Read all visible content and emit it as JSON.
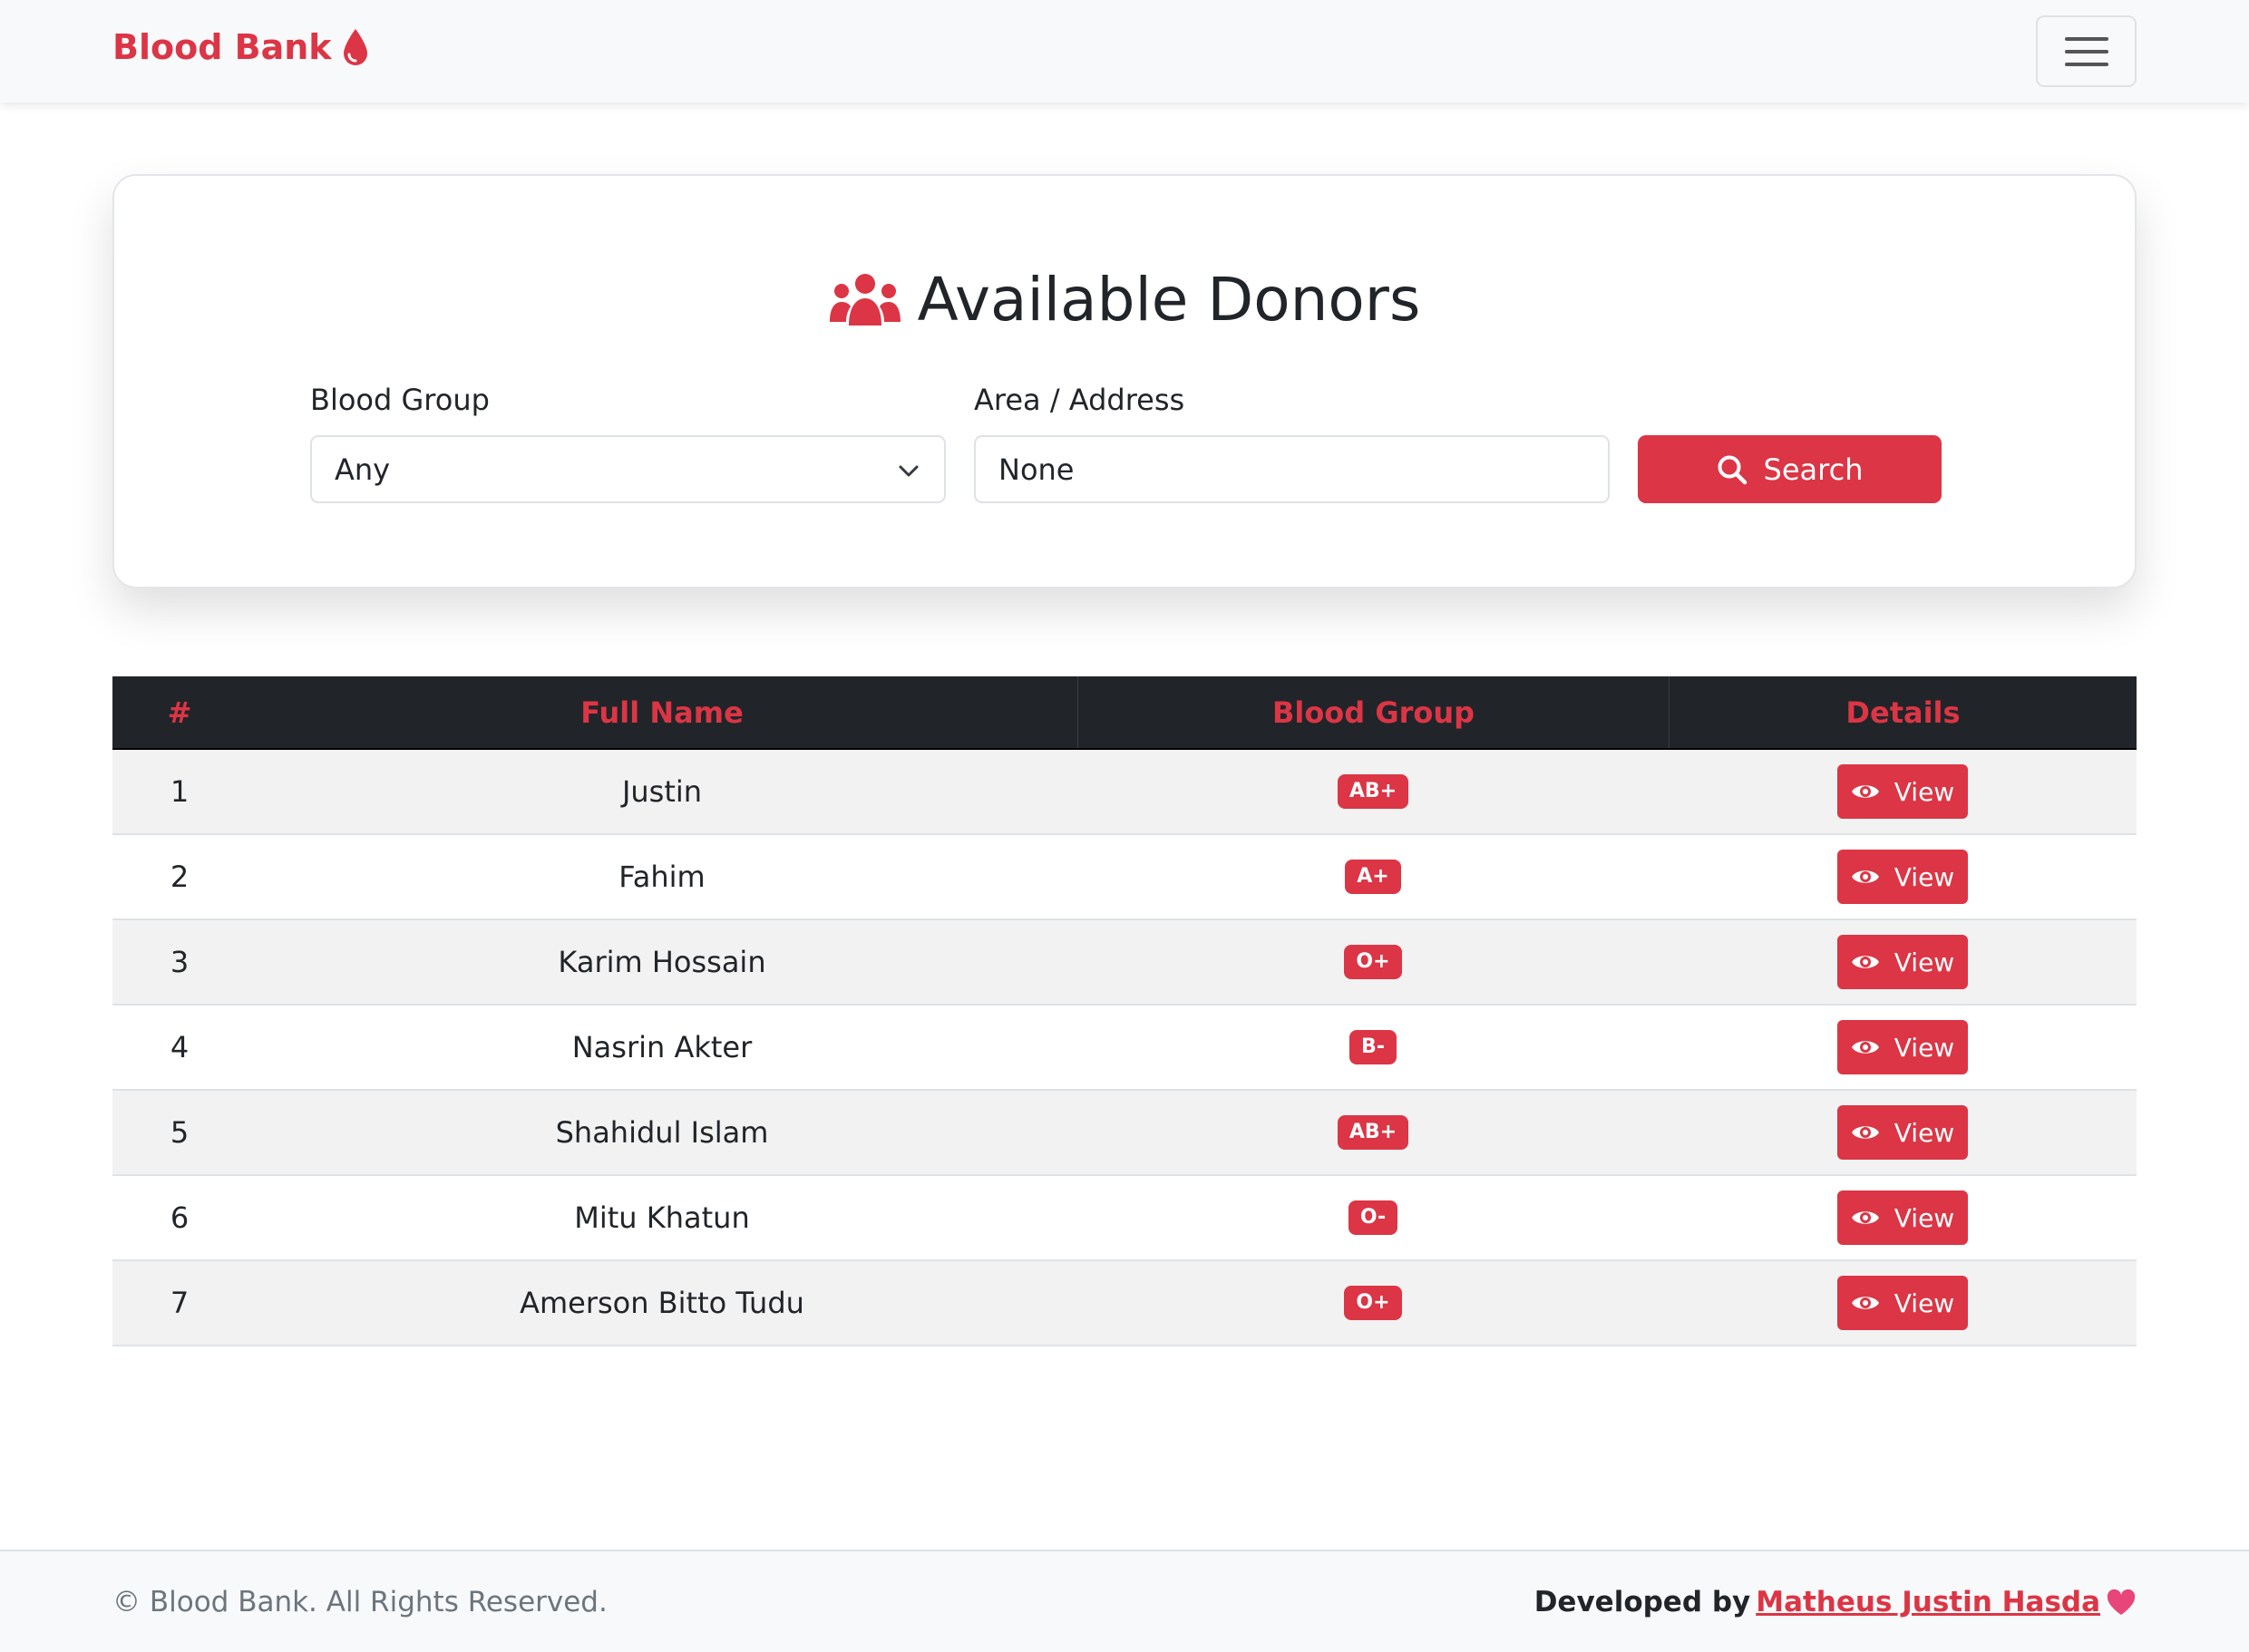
{
  "navbar": {
    "brand": "Blood Bank",
    "brand_icon": "droplet-icon",
    "menu_icon": "hamburger-icon"
  },
  "search": {
    "title": "Available Donors",
    "title_icon": "users-icon",
    "blood_group_label": "Blood Group",
    "blood_group_value": "Any",
    "area_label": "Area / Address",
    "area_value": "None",
    "search_button": "Search"
  },
  "table": {
    "headers": [
      "#",
      "Full Name",
      "Blood Group",
      "Details"
    ],
    "view_label": "View",
    "rows": [
      {
        "num": "1",
        "name": "Justin",
        "group": "AB+"
      },
      {
        "num": "2",
        "name": "Fahim",
        "group": "A+"
      },
      {
        "num": "3",
        "name": "Karim Hossain",
        "group": "O+"
      },
      {
        "num": "4",
        "name": "Nasrin Akter",
        "group": "B-"
      },
      {
        "num": "5",
        "name": "Shahidul Islam",
        "group": "AB+"
      },
      {
        "num": "6",
        "name": "Mitu Khatun",
        "group": "O-"
      },
      {
        "num": "7",
        "name": "Amerson Bitto Tudu",
        "group": "O+"
      }
    ]
  },
  "footer": {
    "copyright": "© Blood Bank. All Rights Reserved.",
    "developed_by": "Developed by",
    "developer": "Matheus Justin Hasda",
    "heart_icon": "heart-icon"
  },
  "colors": {
    "accent": "#dc3545",
    "table_header_bg": "#212529"
  }
}
